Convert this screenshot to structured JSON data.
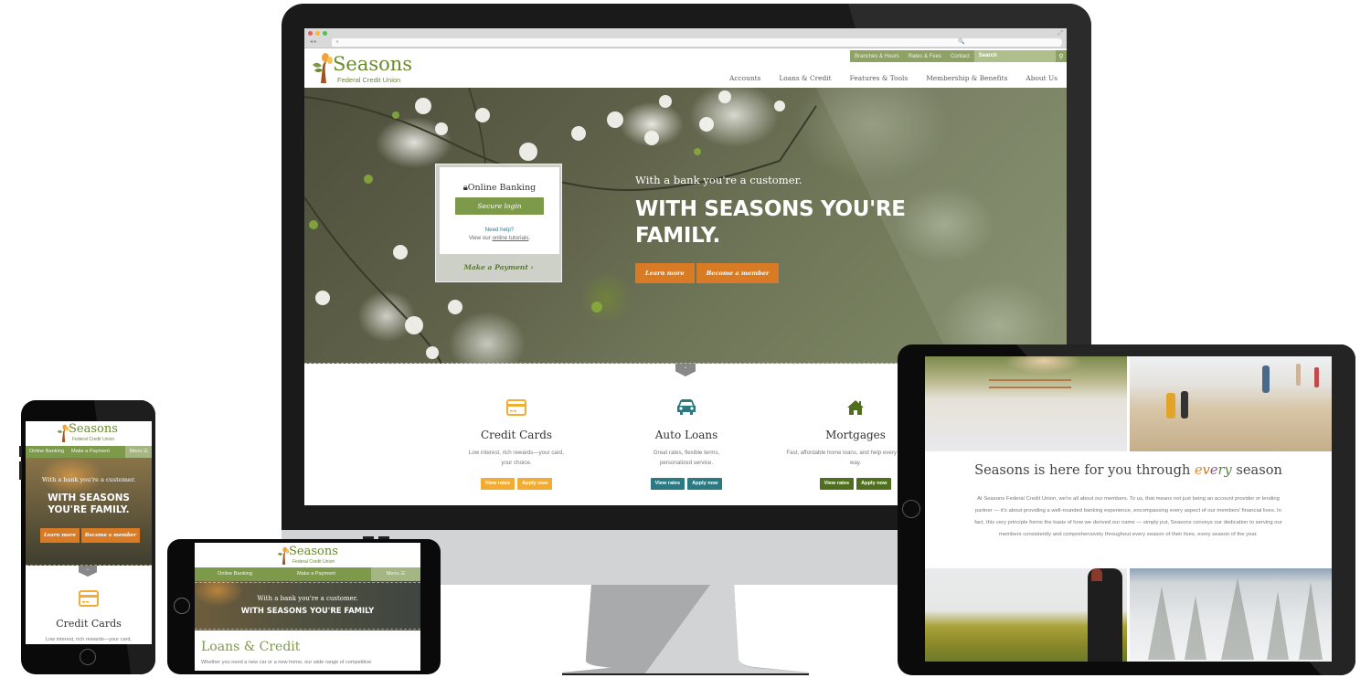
{
  "brand": {
    "name": "Seasons",
    "subtitle": "Federal Credit Union",
    "colors": {
      "green": "#7d9a4a",
      "green_dark": "#5c7a2d",
      "orange": "#d97a25",
      "yellow": "#f3ac33",
      "teal": "#2b7a82",
      "olive": "#4f6f1f"
    }
  },
  "desktop": {
    "browser": {
      "address_placeholder": "+",
      "search_placeholder": "🔍",
      "nav_back": "◂ ▸"
    },
    "utility_nav": [
      "Branches & Hours",
      "Rates & Fees",
      "Contact"
    ],
    "search_label": "Search",
    "main_nav": [
      "Accounts",
      "Loans & Credit",
      "Features & Tools",
      "Membership & Benefits",
      "About Us"
    ],
    "login_card": {
      "title": "Online Banking",
      "button": "Secure login",
      "need_help": "Need help?",
      "tutorials_prefix": "View our ",
      "tutorials_link": "online tutorials",
      "tutorials_suffix": ".",
      "make_payment": "Make a Payment ›"
    },
    "hero": {
      "tagline": "With a bank you're a customer.",
      "headline": "WITH SEASONS YOU'RE FAMILY.",
      "buttons": [
        "Learn more",
        "Become a member"
      ]
    },
    "features": [
      {
        "title": "Credit Cards",
        "description": "Low interest, rich rewards—your card, your choice.",
        "icon": "credit-card-icon",
        "color": "#f3ac33",
        "buttons": [
          "View rates",
          "Apply now"
        ]
      },
      {
        "title": "Auto Loans",
        "description": "Great rates, flexible terms, personalized service.",
        "icon": "car-icon",
        "color": "#2b7a82",
        "buttons": [
          "View rates",
          "Apply now"
        ]
      },
      {
        "title": "Mortgages",
        "description": "Fast, affordable home loans, and help every step of the way.",
        "icon": "home-icon",
        "color": "#4f6f1f",
        "buttons": [
          "View rates",
          "Apply now"
        ]
      }
    ]
  },
  "tablet": {
    "heading_prefix": "Seasons is here for you through ",
    "heading_emph": "every",
    "heading_suffix": " season",
    "body": "At Seasons Federal Credit Union, we're all about our members. To us, that means not just being an account provider or lending partner — it's about providing a well-rounded banking experience, encompassing every aspect of our members' financial lives. In fact, this very principle forms the basis of how we derived our name — simply put, Seasons conveys our dedication to serving our members consistently and comprehensively throughout every season of their lives, every season of the year.",
    "photos": [
      "summer-park-photo",
      "beach-photo",
      "autumn-hills-photo",
      "winter-forest-photo"
    ]
  },
  "phone_portrait": {
    "nav": [
      "Online Banking",
      "Make a Payment"
    ],
    "menu": "Menu ☰",
    "tagline": "With a bank you're a customer.",
    "headline": "WITH SEASONS YOU'RE FAMILY.",
    "buttons": [
      "Learn more",
      "Become a member"
    ],
    "feature_title": "Credit Cards",
    "feature_desc": "Low interest, rich rewards—your card,"
  },
  "phone_landscape": {
    "nav": [
      "Online Banking",
      "Make a Payment"
    ],
    "menu": "Menu ☰",
    "tagline": "With a bank you're a customer.",
    "headline": "WITH SEASONS YOU'RE FAMILY",
    "section_title": "Loans & Credit",
    "section_text": "Whether you need a new car or a new home, our  wide range of competitive"
  }
}
